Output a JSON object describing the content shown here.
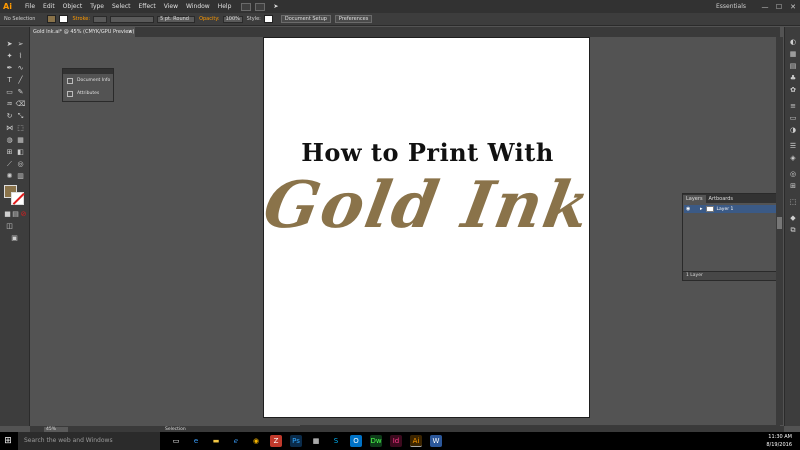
{
  "app": {
    "logo": "Ai"
  },
  "menu": [
    "File",
    "Edit",
    "Object",
    "Type",
    "Select",
    "Effect",
    "View",
    "Window",
    "Help"
  ],
  "workspace": "Essentials",
  "window_controls": {
    "minimize": "—",
    "maximize": "☐",
    "close": "✕"
  },
  "control": {
    "selection_label": "No Selection",
    "stroke_label": "Stroke:",
    "brush_label": "5 pt. Round",
    "opacity_label": "Opacity:",
    "opacity_value": "100%",
    "style_label": "Style:",
    "doc_setup": "Document Setup",
    "preferences": "Preferences"
  },
  "doc_tab": {
    "title": "Gold Ink.ai* @ 45% (CMYK/GPU Preview)",
    "close": "×"
  },
  "artboard": {
    "heading": "How to Print With",
    "script_text": "Gold Ink",
    "colors": {
      "gold": "#8a734a",
      "black": "#111111"
    }
  },
  "doc_panel": {
    "items": [
      "Document Info",
      "Attributes"
    ]
  },
  "layers_panel": {
    "tabs": [
      "Layers",
      "Artboards"
    ],
    "layer_name": "Layer 1",
    "count_label": "1 Layer"
  },
  "status": {
    "zoom": "45%",
    "tool": "Selection"
  },
  "taskbar": {
    "search_placeholder": "Search the web and Windows",
    "time": "11:30 AM",
    "date": "8/19/2016"
  }
}
